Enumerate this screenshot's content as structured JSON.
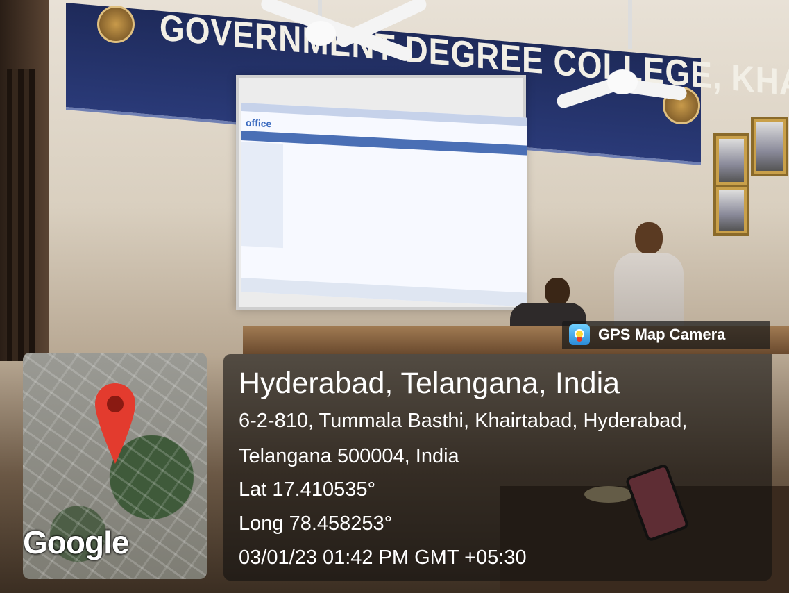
{
  "scene": {
    "banner_text": "GOVERNMENT DEGREE COLLEGE, KHAIRATABAD",
    "projected_logo": "office"
  },
  "overlay": {
    "app_name": "GPS Map Camera",
    "app_icon": "gps-map-camera-icon",
    "location_title": "Hyderabad, Telangana, India",
    "address_line_1": "6-2-810, Tummala Basthi, Khairtabad, Hyderabad,",
    "address_line_2": "Telangana 500004, India",
    "latitude": "Lat 17.410535°",
    "longitude": "Long 78.458253°",
    "timestamp": "03/01/23 01:42 PM GMT +05:30",
    "map_attribution": "Google",
    "pin_icon": "map-pin-icon",
    "pin_color": "#e33b2e"
  }
}
